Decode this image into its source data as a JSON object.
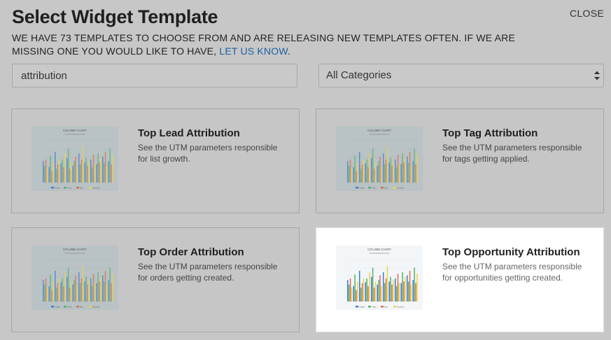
{
  "header": {
    "title": "Select Widget Template",
    "close_label": "CLOSE",
    "subtitle_text": "WE HAVE 73 TEMPLATES TO CHOOSE FROM AND ARE RELEASING NEW TEMPLATES OFTEN. IF WE ARE MISSING ONE YOU WOULD LIKE TO HAVE, ",
    "subtitle_link": "LET US KNOW",
    "subtitle_end": "."
  },
  "filters": {
    "search_value": "attribution",
    "category_selected": "All Categories"
  },
  "colors": {
    "link": "#1a5f9e",
    "overlay": "#c7c7c7",
    "highlight_card": "#ffffff"
  },
  "thumbnail": {
    "chart_title": "COLUMN CHART",
    "chart_subtitle": "SOURCE BREAKDOWN",
    "legend": [
      "Google",
      "Yahoo",
      "Bing",
      "Facebook"
    ],
    "series_colors": [
      "#3b7bd4",
      "#4fb36b",
      "#e06b4e",
      "#f0d346"
    ]
  },
  "templates": [
    {
      "name": "Top Lead Attribution",
      "description": "See the UTM parameters responsible for list growth.",
      "highlighted": false
    },
    {
      "name": "Top Tag Attribution",
      "description": "See the UTM parameters responsible for tags getting applied.",
      "highlighted": false
    },
    {
      "name": "Top Order Attribution",
      "description": "See the UTM parameters responsible for orders getting created.",
      "highlighted": false
    },
    {
      "name": "Top Opportunity Attribution",
      "description": "See the UTM parameters responsible for opportunities getting created.",
      "highlighted": true
    }
  ]
}
